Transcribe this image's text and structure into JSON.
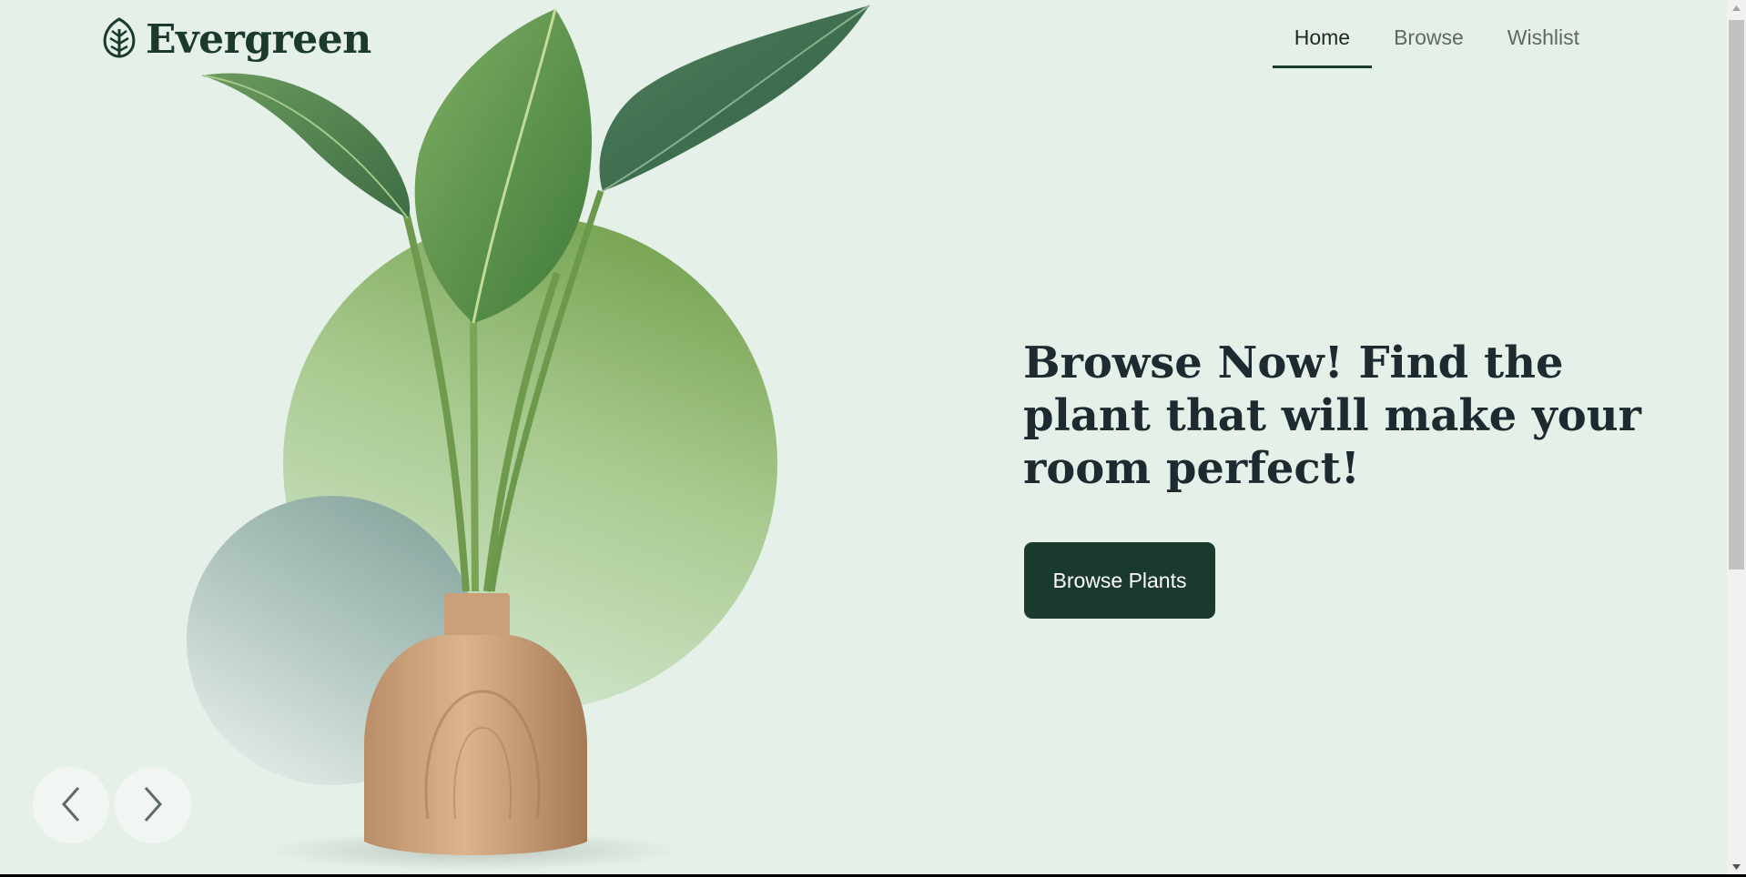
{
  "header": {
    "brand_name": "Evergreen",
    "logo_icon": "leaf-icon"
  },
  "nav": {
    "items": [
      {
        "label": "Home",
        "active": true
      },
      {
        "label": "Browse",
        "active": false
      },
      {
        "label": "Wishlist",
        "active": false
      }
    ]
  },
  "hero": {
    "title": "Browse Now! Find the plant that will make your room perfect!",
    "cta_label": "Browse Plants"
  },
  "carousel": {
    "prev_icon": "chevron-left-icon",
    "next_icon": "chevron-right-icon"
  },
  "colors": {
    "background": "#e5f0e8",
    "primary": "#1a3a2e",
    "text_dark": "#1d2a30",
    "nav_inactive": "#5b6b63"
  }
}
